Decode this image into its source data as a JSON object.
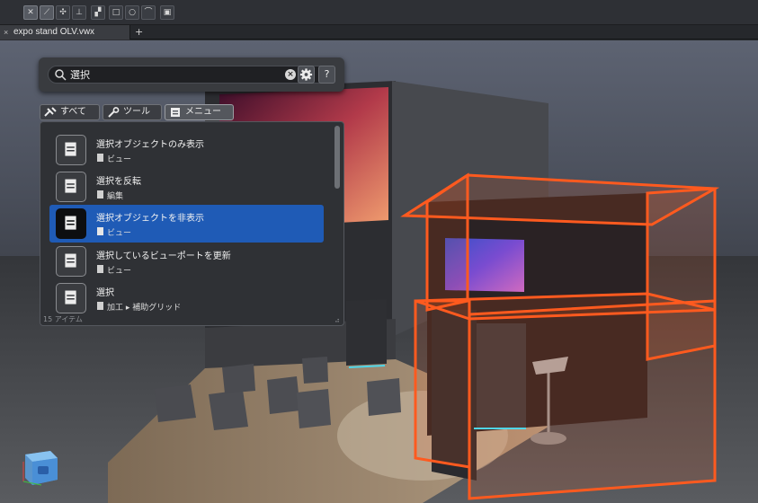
{
  "document": {
    "tab_title": "expo stand OLV.vwx",
    "close_glyph": "×",
    "add_glyph": "+"
  },
  "search": {
    "query": "選択",
    "clear_glyph": "×",
    "help_label": "?"
  },
  "filters": [
    {
      "label": "すべて",
      "icon": "all-tools-icon",
      "active": false
    },
    {
      "label": "ツール",
      "icon": "wrench-icon",
      "active": false
    },
    {
      "label": "メニュー",
      "icon": "menu-icon",
      "active": true
    }
  ],
  "results": {
    "items": [
      {
        "title": "選択オブジェクトのみ表示",
        "category": "ビュー",
        "selected": false
      },
      {
        "title": "選択を反転",
        "category": "編集",
        "selected": false
      },
      {
        "title": "選択オブジェクトを非表示",
        "category": "ビュー",
        "selected": true
      },
      {
        "title": "選択しているビューポートを更新",
        "category": "ビュー",
        "selected": false
      },
      {
        "title": "選択",
        "category": "加工 ▸ 補助グリッド",
        "selected": false
      }
    ],
    "count_label": "15 アイテム"
  },
  "colors": {
    "accent": "#1f5bb6",
    "frame_orange": "#ff5a1f",
    "panel": "#2f3135"
  },
  "icons": {
    "search": "search-icon",
    "gear": "gear-icon",
    "menu_item": "menu-command-icon",
    "nav": "view-cube-icon"
  }
}
